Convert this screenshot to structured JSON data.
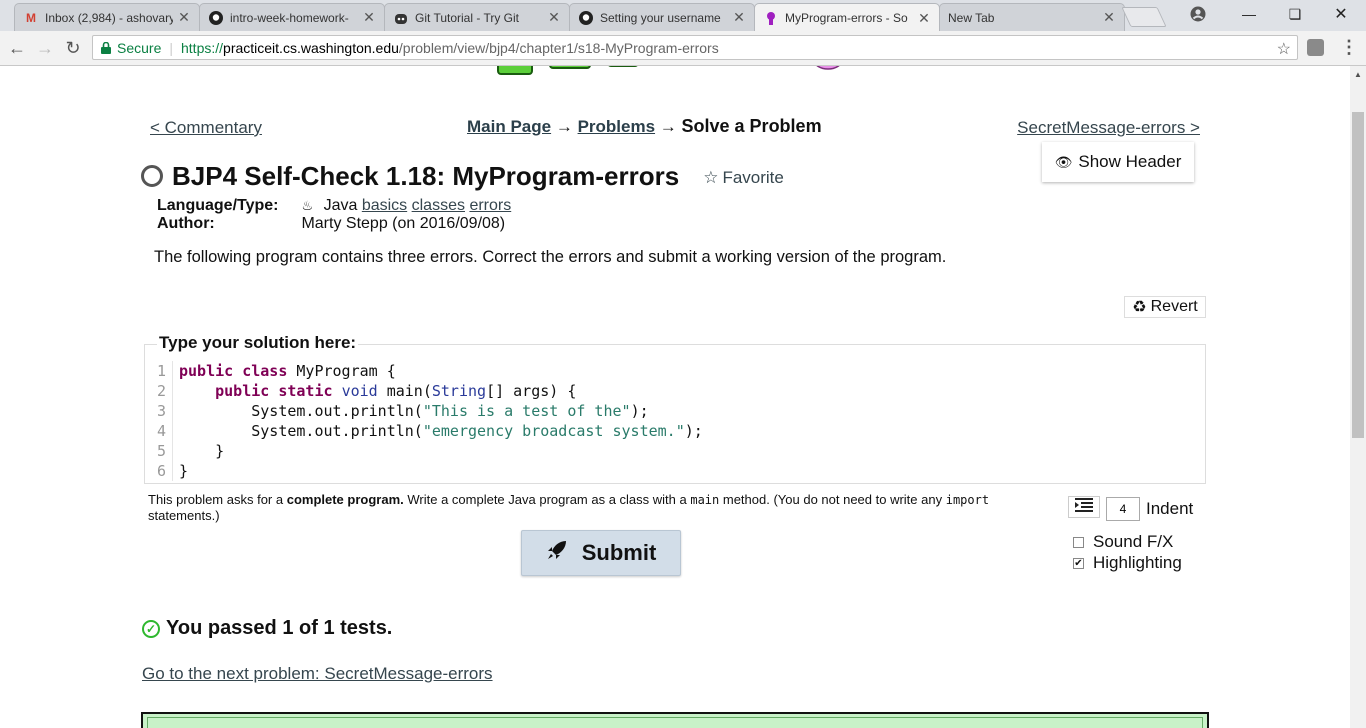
{
  "browser": {
    "tabs": [
      {
        "title": "Inbox (2,984) - ashovary",
        "icon": "gmail-icon"
      },
      {
        "title": "intro-week-homework-",
        "icon": "github-icon"
      },
      {
        "title": "Git Tutorial - Try Git",
        "icon": "octocat-icon"
      },
      {
        "title": "Setting your username",
        "icon": "github-icon"
      },
      {
        "title": "MyProgram-errors - So",
        "icon": "practiceit-icon",
        "active": true
      },
      {
        "title": "New Tab",
        "icon": ""
      }
    ],
    "secure_label": "Secure",
    "url_scheme": "https://",
    "url_host": "practiceit.cs.washington.edu",
    "url_path": "/problem/view/bjp4/chapter1/s18-MyProgram-errors"
  },
  "nav": {
    "prev": "< Commentary",
    "next": "SecretMessage-errors >",
    "crumb_main": "Main Page",
    "crumb_arrow": "→",
    "crumb_problems": "Problems",
    "crumb_current": "Solve a Problem"
  },
  "show_header_label": "Show Header",
  "problem": {
    "title": "BJP4 Self-Check 1.18: MyProgram-errors",
    "favorite_label": "Favorite",
    "language_label": "Language/Type:",
    "language": "Java",
    "tags": [
      "basics",
      "classes",
      "errors"
    ],
    "author_label": "Author:",
    "author": "Marty Stepp (on 2016/09/08)",
    "description": "The following program contains three errors. Correct the errors and submit a working version of the program."
  },
  "revert_label": "Revert",
  "solution": {
    "label": "Type your solution here:",
    "line_numbers": [
      "1",
      "2",
      "3",
      "4",
      "5",
      "6"
    ]
  },
  "hint": {
    "p1": "This problem asks for a ",
    "bold": "complete program.",
    "p2": " Write a complete Java program as a class with a ",
    "code1": "main",
    "p3": " method. (You do not need to write any ",
    "code2": "import",
    "p4": " statements.)"
  },
  "indent": {
    "value": "4",
    "label": "Indent"
  },
  "submit_label": "Submit",
  "options": {
    "sound": {
      "label": "Sound F/X",
      "checked": false
    },
    "highlighting": {
      "label": "Highlighting",
      "checked": true
    }
  },
  "result": {
    "passed_text": "You passed 1 of 1 tests.",
    "next_link": "Go to the next problem: SecretMessage-errors"
  }
}
